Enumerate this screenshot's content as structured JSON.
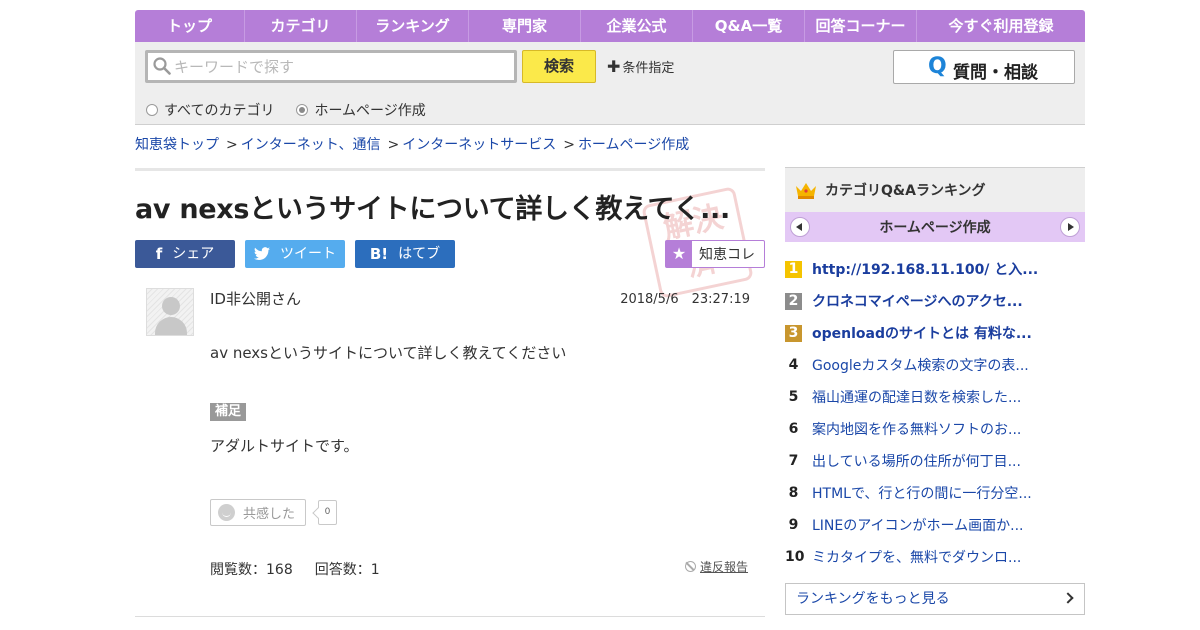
{
  "nav": {
    "items": [
      "トップ",
      "カテゴリ",
      "ランキング",
      "専門家",
      "企業公式",
      "Q&A一覧",
      "回答コーナー",
      "今すぐ利用登録"
    ]
  },
  "search": {
    "placeholder": "キーワードで探す",
    "button": "検索",
    "condition": "条件指定",
    "radio_all": "すべてのカテゴリ",
    "radio_current": "ホームページ作成",
    "selected": "ホームページ作成",
    "ask_q": "Q",
    "ask_label": "質問・相談"
  },
  "breadcrumb": {
    "sep": ">",
    "items": [
      "知恵袋トップ",
      "インターネット、通信",
      "インターネットサービス",
      "ホームページ作成"
    ]
  },
  "question": {
    "title": "av nexsというサイトについて詳しく教えてく...",
    "stamp": "解決済",
    "share": {
      "facebook_icon": "f",
      "facebook": "シェア",
      "twitter": "ツイート",
      "hatena_icon": "B!",
      "hatena": "はてブ"
    },
    "collect_icon": "★",
    "collect": "知恵コレ",
    "user": "ID非公開さん",
    "date": "2018/5/6　23:27:19",
    "body": "av nexsというサイトについて詳しく教えてください",
    "supplement_label": "補足",
    "supplement": "アダルトサイトです。",
    "empathy_label": "共感した",
    "empathy_count": "0",
    "views": "閲覧数：168",
    "answers": "回答数：1",
    "report": "違反報告"
  },
  "ranking": {
    "title": "カテゴリQ&Aランキング",
    "category": "ホームページ作成",
    "items": [
      {
        "num": "1",
        "text": "http://192.168.11.100/ と入...",
        "color": "#f5c400"
      },
      {
        "num": "2",
        "text": "クロネコマイページへのアクセ...",
        "color": "#8c8c8c"
      },
      {
        "num": "3",
        "text": "openloadのサイトとは 有料な...",
        "color": "#c8962e"
      },
      {
        "num": "4",
        "text": "Googleカスタム検索の文字の表..."
      },
      {
        "num": "5",
        "text": "福山通運の配達日数を検索した..."
      },
      {
        "num": "6",
        "text": "案内地図を作る無料ソフトのお..."
      },
      {
        "num": "7",
        "text": "出している場所の住所が何丁目..."
      },
      {
        "num": "8",
        "text": "HTMLで、行と行の間に一行分空..."
      },
      {
        "num": "9",
        "text": "LINEのアイコンがホーム画面か..."
      },
      {
        "num": "10",
        "text": "ミカタイプを、無料でダウンロ..."
      }
    ],
    "more": "ランキングをもっと見る"
  },
  "colors": {
    "nav_purple": "#b57ed8",
    "category_lavender": "#e3c8f5",
    "search_yellow": "#fbe94a",
    "link_blue": "#1a47a8",
    "facebook": "#3b5998",
    "twitter": "#55acee",
    "hatena": "#2c6ebd"
  }
}
